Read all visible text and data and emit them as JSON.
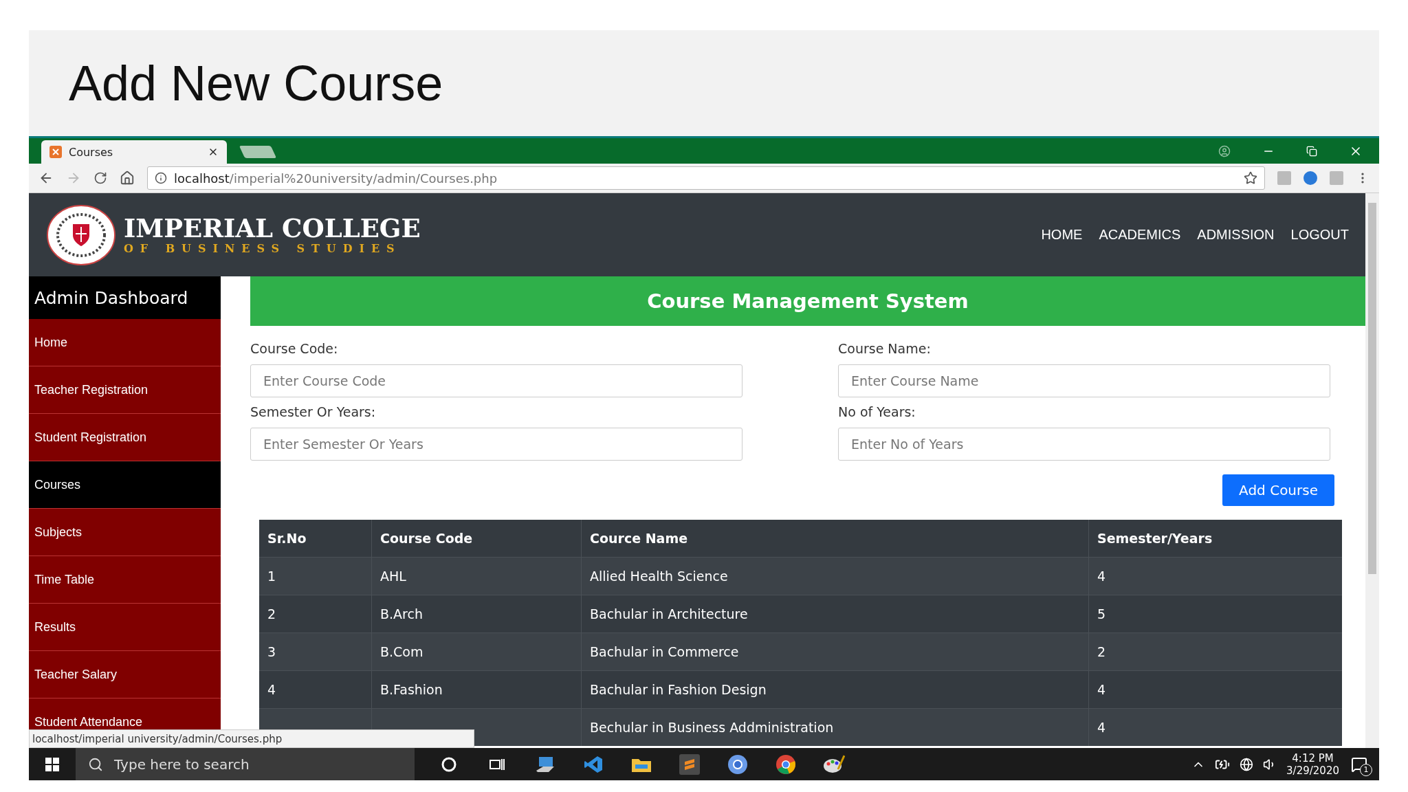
{
  "slide_title": "Add New Course",
  "browser": {
    "tab_title": "Courses",
    "url_host": "localhost",
    "url_path": "/imperial%20university/admin/Courses.php"
  },
  "site": {
    "brand_name": "IMPERIAL COLLEGE",
    "brand_tagline": "OF BUSINESS STUDIES",
    "nav": [
      "HOME",
      "ACADEMICS",
      "ADMISSION",
      "LOGOUT"
    ]
  },
  "sidebar": {
    "title": "Admin Dashboard",
    "items": [
      {
        "label": "Home",
        "selected": false
      },
      {
        "label": "Teacher Registration",
        "selected": false
      },
      {
        "label": "Student Registration",
        "selected": false
      },
      {
        "label": "Courses",
        "selected": true
      },
      {
        "label": "Subjects",
        "selected": false
      },
      {
        "label": "Time Table",
        "selected": false
      },
      {
        "label": "Results",
        "selected": false
      },
      {
        "label": "Teacher Salary",
        "selected": false
      },
      {
        "label": "Student Attendance",
        "selected": false
      }
    ]
  },
  "panel": {
    "title": "Course Management System",
    "fields": [
      {
        "label": "Course Code:",
        "placeholder": "Enter Course Code"
      },
      {
        "label": "Course Name:",
        "placeholder": "Enter Course Name"
      },
      {
        "label": "Semester Or Years:",
        "placeholder": "Enter Semester Or Years"
      },
      {
        "label": "No of Years:",
        "placeholder": "Enter No of Years"
      }
    ],
    "submit": "Add Course"
  },
  "table": {
    "columns": [
      "Sr.No",
      "Course Code",
      "Cource Name",
      "Semester/Years"
    ],
    "rows": [
      {
        "sr_no": "1",
        "code": "AHL",
        "name": "Allied Health Science",
        "semester": "4"
      },
      {
        "sr_no": "2",
        "code": "B.Arch",
        "name": "Bachular in Architecture",
        "semester": "5"
      },
      {
        "sr_no": "3",
        "code": "B.Com",
        "name": "Bachular in Commerce",
        "semester": "2"
      },
      {
        "sr_no": "4",
        "code": "B.Fashion",
        "name": "Bachular in Fashion Design",
        "semester": "4"
      },
      {
        "name": "Bechular in Business Addministration",
        "semester": "4"
      }
    ]
  },
  "status_url": "localhost/imperial university/admin/Courses.php",
  "taskbar": {
    "search_placeholder": "Type here to search",
    "time": "4:12 PM",
    "date": "3/29/2020",
    "notification_count": "1"
  }
}
